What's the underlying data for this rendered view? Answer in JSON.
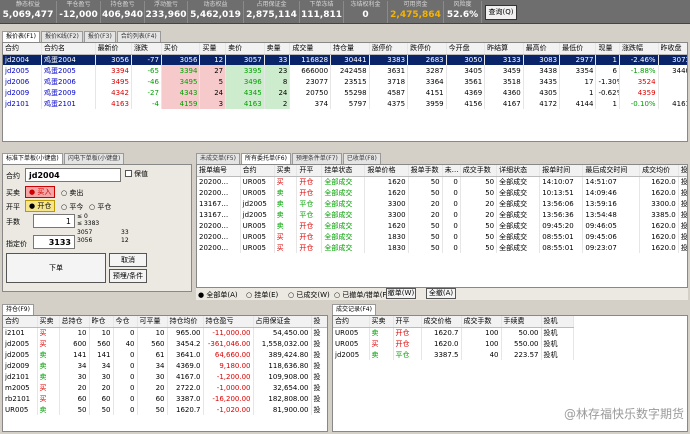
{
  "topbar": {
    "cells": [
      {
        "label": "静态权益",
        "value": "5,069,477"
      },
      {
        "label": "平仓盈亏",
        "value": "-12,000"
      },
      {
        "label": "持仓盈亏",
        "value": "406,940"
      },
      {
        "label": "浮动盈亏",
        "value": "233,960"
      },
      {
        "label": "动态权益",
        "value": "5,462,019"
      },
      {
        "label": "占用保证金",
        "value": "2,875,114"
      },
      {
        "label": "下单冻结",
        "value": "111,811"
      },
      {
        "label": "冻结权利金",
        "value": "0"
      },
      {
        "label": "可用资金",
        "value": "2,475,864"
      },
      {
        "label": "风险度",
        "value": "52.6%"
      }
    ],
    "query_button": "查询(Q)"
  },
  "market": {
    "tabs": [
      "报价表(F1)",
      "报价K线(F2)",
      "报价(F3)",
      "合约列表(F4)"
    ],
    "headers": [
      "合约",
      "合约名",
      "最新价",
      "涨跌",
      "买价",
      "买量",
      "卖价",
      "卖量",
      "成交量",
      "持仓量",
      "涨停价",
      "跌停价",
      "今开盘",
      "昨结算",
      "最高价",
      "最低价",
      "现量",
      "涨跌幅",
      "昨收盘"
    ],
    "rows": [
      [
        "jd2004",
        "鸡蛋2004",
        "3056",
        "-77",
        "3056",
        "12",
        "3057",
        "33",
        "116828",
        "30441",
        "3383",
        "2683",
        "3050",
        "3133",
        "3083",
        "2977",
        "1",
        "-2.46%",
        "3073"
      ],
      [
        "jd2005",
        "鸡蛋2005",
        "3394",
        "-65",
        "3394",
        "27",
        "3395",
        "23",
        "666000",
        "242458",
        "3631",
        "3287",
        "3405",
        "3459",
        "3438",
        "3354",
        "6",
        "-1.88%",
        "3440"
      ],
      [
        "jd2006",
        "鸡蛋2006",
        "3495",
        "-46",
        "3495",
        "5",
        "3496",
        "8",
        "23077",
        "23515",
        "3718",
        "3364",
        "3561",
        "3518",
        "3435",
        "17",
        "-1.30%",
        "3524"
      ],
      [
        "jd2009",
        "鸡蛋2009",
        "4342",
        "-27",
        "4343",
        "24",
        "4345",
        "24",
        "20750",
        "55298",
        "4587",
        "4151",
        "4369",
        "4360",
        "4305",
        "1",
        "-0.62%",
        "4359"
      ],
      [
        "jd2101",
        "鸡蛋2101",
        "4163",
        "-4",
        "4159",
        "3",
        "4163",
        "2",
        "374",
        "5797",
        "4375",
        "3959",
        "4156",
        "4167",
        "4172",
        "4144",
        "1",
        "-0.10%",
        "4161"
      ]
    ]
  },
  "order_entry": {
    "tabs": [
      "标准下单板(小键盘)",
      "闪电下单板(小键盘)"
    ],
    "contract_label": "合约",
    "contract": "jd2004",
    "hedge_label": "保值",
    "buysell_label": "买卖",
    "buy": "买入",
    "sell": "卖出",
    "offset_label": "开平",
    "open": "开仓",
    "close_today": "平今",
    "close": "平仓",
    "qty_label": "手数",
    "qty": "1",
    "qty_max": "0",
    "qty_avail": "3383",
    "price_label": "指定价",
    "price": "3133",
    "price_hint1": "3057",
    "price_hint2": "33",
    "price_hint3": "3056",
    "price_hint4": "12",
    "submit": "下单",
    "cancel": "取消",
    "advanced": "预埋/条件"
  },
  "orders": {
    "tabs": [
      "未成交单(F5)",
      "所有委托单(F6)",
      "预埋条件单(F7)",
      "已收单(F8)"
    ],
    "headers": [
      "报单编号",
      "合约",
      "买卖",
      "开平",
      "挂单状态",
      "报单价格",
      "报单手数",
      "未…",
      "成交手数",
      "详细状态",
      "报单时间",
      "最后成交时间",
      "成交均价",
      "投"
    ],
    "rows": [
      [
        "20200…",
        "UR005",
        "买",
        "开仓",
        "全部成交",
        "1620",
        "50",
        "0",
        "50",
        "全部成交",
        "14:10:07",
        "14:51:07",
        "1620.0",
        "投机"
      ],
      [
        "20200…",
        "UR005",
        "卖",
        "开仓",
        "全部成交",
        "1620",
        "50",
        "0",
        "50",
        "全部成交",
        "10:13:51",
        "14:09:46",
        "1620.0",
        "投机"
      ],
      [
        "13167…",
        "jd2005",
        "卖",
        "平仓",
        "全部成交",
        "3300",
        "20",
        "0",
        "20",
        "全部成交",
        "13:56:06",
        "13:59:16",
        "3300.0",
        "投机"
      ],
      [
        "13167…",
        "jd2005",
        "卖",
        "平仓",
        "全部成交",
        "3300",
        "20",
        "0",
        "20",
        "全部成交",
        "13:56:36",
        "13:54:48",
        "3385.0",
        "投机"
      ],
      [
        "20200…",
        "UR005",
        "卖",
        "开仓",
        "全部成交",
        "1620",
        "50",
        "0",
        "50",
        "全部成交",
        "09:45:20",
        "09:46:05",
        "1620.0",
        "投机"
      ],
      [
        "20200…",
        "UR005",
        "买",
        "开仓",
        "全部成交",
        "1830",
        "50",
        "0",
        "50",
        "全部成交",
        "08:55:01",
        "09:45:06",
        "1620.0",
        "投机"
      ],
      [
        "20200…",
        "UR005",
        "买",
        "开仓",
        "全部成交",
        "1830",
        "50",
        "0",
        "50",
        "全部成交",
        "08:55:01",
        "09:23:07",
        "1620.0",
        "投机"
      ]
    ],
    "radios": [
      "全部单(A)",
      "挂单(E)",
      "已成交(W)",
      "已撤单/错单(F)"
    ],
    "cancel_btn": "撤单(W)",
    "cancel_all_btn": "全撤(A)"
  },
  "positions": {
    "tabs": [
      "持仓(F9)"
    ],
    "headers": [
      "合约",
      "买卖",
      "总持仓",
      "昨仓",
      "今仓",
      "可平量",
      "持仓均价",
      "持仓盈亏",
      "占用保证金",
      "投"
    ],
    "rows": [
      [
        "i2101",
        "买",
        "10",
        "10",
        "0",
        "10",
        "965.00",
        "-11,000.00",
        "54,450.00",
        "投"
      ],
      [
        "jd2005",
        "买",
        "600",
        "560",
        "40",
        "560",
        "3454.2",
        "-361,046.00",
        "1,558,032.00",
        "投"
      ],
      [
        "jd2005",
        "卖",
        "141",
        "141",
        "0",
        "61",
        "3641.0",
        "64,660.00",
        "389,424.80",
        "投"
      ],
      [
        "jd2009",
        "卖",
        "34",
        "34",
        "0",
        "34",
        "4369.0",
        "9,180.00",
        "118,636.80",
        "投"
      ],
      [
        "jd2101",
        "卖",
        "30",
        "30",
        "0",
        "30",
        "4167.0",
        "-1,200.00",
        "109,908.00",
        "投"
      ],
      [
        "m2005",
        "买",
        "20",
        "20",
        "0",
        "20",
        "2722.0",
        "-1,000.00",
        "32,654.00",
        "投"
      ],
      [
        "rb2101",
        "买",
        "60",
        "60",
        "0",
        "60",
        "3387.0",
        "-16,200.00",
        "182,808.00",
        "投"
      ],
      [
        "UR005",
        "卖",
        "50",
        "50",
        "0",
        "50",
        "1620.7",
        "-1,020.00",
        "81,900.00",
        "投"
      ]
    ]
  },
  "trades": {
    "tabs": [
      "成交记录(F4)"
    ],
    "headers": [
      "合约",
      "买卖",
      "开平",
      "成交价格",
      "成交手数",
      "手续费",
      "投机"
    ],
    "rows": [
      [
        "UR005",
        "卖",
        "开仓",
        "1620.7",
        "100",
        "50.00",
        "投机"
      ],
      [
        "UR005",
        "买",
        "开仓",
        "1620.0",
        "100",
        "550.00",
        "投机"
      ],
      [
        "jd2005",
        "卖",
        "平仓",
        "3387.5",
        "40",
        "223.57",
        "投机"
      ]
    ]
  },
  "watermark": "@林存福快乐数字期货"
}
